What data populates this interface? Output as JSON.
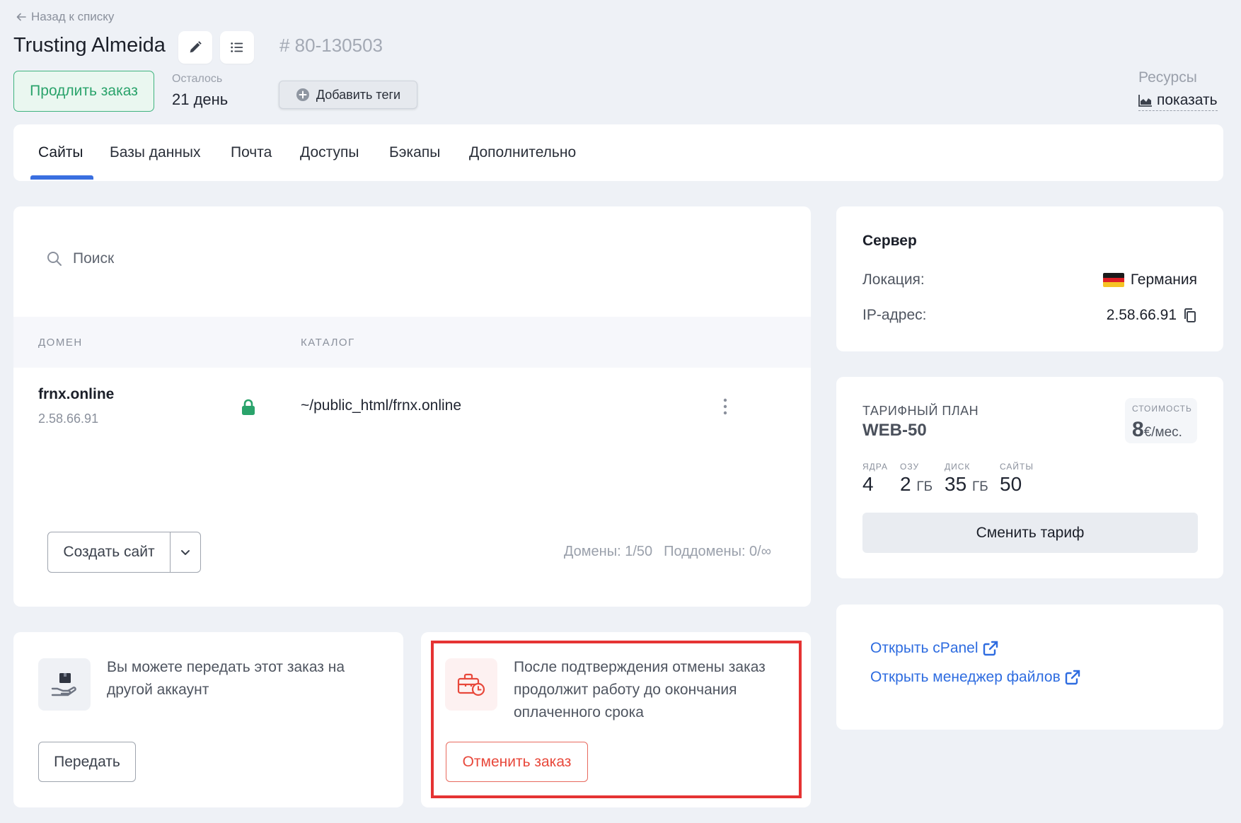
{
  "header": {
    "back_label": "Назад к списку",
    "order_title": "Trusting Almeida",
    "order_number": "# 80-130503",
    "extend_label": "Продлить заказ",
    "remaining_label": "Осталось",
    "remaining_value": "21 день",
    "add_tags_label": "Добавить теги",
    "resources_label": "Ресурсы",
    "resources_link": "показать"
  },
  "tabs": [
    {
      "label": "Сайты",
      "active": true
    },
    {
      "label": "Базы данных",
      "active": false
    },
    {
      "label": "Почта",
      "active": false
    },
    {
      "label": "Доступы",
      "active": false
    },
    {
      "label": "Бэкапы",
      "active": false
    },
    {
      "label": "Дополнительно",
      "active": false
    }
  ],
  "sites": {
    "search_placeholder": "Поиск",
    "columns": [
      "ДОМЕН",
      "КАТАЛОГ"
    ],
    "rows": [
      {
        "domain": "frnx.online",
        "ip": "2.58.66.91",
        "catalog": "~/public_html/frnx.online",
        "ssl": true
      }
    ],
    "create_label": "Создать сайт",
    "domains_count": "Домены: 1/50",
    "subdomains_count": "Поддомены: 0/∞"
  },
  "transfer": {
    "text": "Вы можете передать этот заказ на другой аккаунт",
    "button": "Передать"
  },
  "cancel": {
    "text": "После подтверждения отмены заказ продолжит работу до окончания оплаченного срока",
    "button": "Отменить заказ",
    "highlight_color": "#e53333"
  },
  "server": {
    "title": "Сервер",
    "location_label": "Локация:",
    "location_value": "Германия",
    "ip_label": "IP-адрес:",
    "ip_value": "2.58.66.91"
  },
  "plan": {
    "label": "ТАРИФНЫЙ ПЛАН",
    "name": "WEB-50",
    "price_label": "СТОИМОСТЬ",
    "price_amount": "8",
    "price_unit": "€/мес.",
    "specs": [
      {
        "label": "ЯДРА",
        "value": "4",
        "unit": ""
      },
      {
        "label": "ОЗУ",
        "value": "2",
        "unit": "ГБ"
      },
      {
        "label": "ДИСК",
        "value": "35",
        "unit": "ГБ"
      },
      {
        "label": "САЙТЫ",
        "value": "50",
        "unit": ""
      }
    ],
    "change_label": "Сменить тариф"
  },
  "links": {
    "cpanel": "Открыть cPanel",
    "file_manager": "Открыть менеджер файлов"
  },
  "colors": {
    "accent": "#3a6fe0",
    "success": "#2aa36b",
    "danger": "#e8483b",
    "link": "#2e6ce0"
  }
}
